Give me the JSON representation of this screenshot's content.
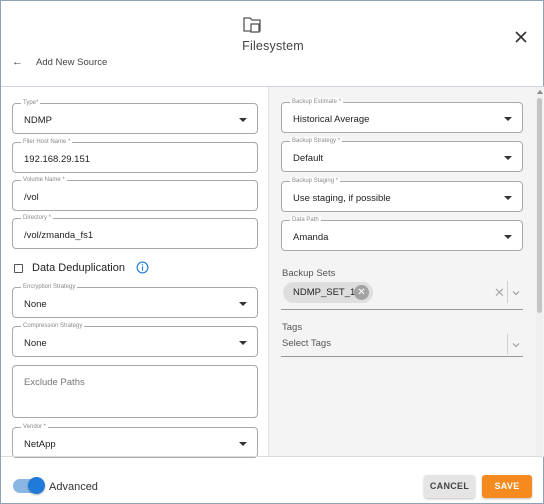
{
  "header": {
    "title": "Filesystem",
    "back_label": "Add New Source",
    "icon": "folder-copy-icon"
  },
  "left": {
    "type": {
      "label": "Type*",
      "value": "NDMP"
    },
    "filer_host": {
      "label": "Filer Host Name *",
      "value": "192.168.29.151"
    },
    "volume": {
      "label": "Volume Name *",
      "value": "/vol"
    },
    "directory": {
      "label": "Directory *",
      "value": "/vol/zmanda_fs1"
    },
    "dedup": {
      "label": "Data Deduplication",
      "checked": false
    },
    "encryption": {
      "label": "Encryption Strategy",
      "value": "None"
    },
    "compression": {
      "label": "Compression Strategy",
      "value": "None"
    },
    "exclude": {
      "placeholder": "Exclude Paths"
    },
    "vendor": {
      "label": "Vendor *",
      "value": "NetApp"
    }
  },
  "right": {
    "estimate": {
      "label": "Backup Estimate *",
      "value": "Historical Average"
    },
    "strategy": {
      "label": "Backup Strategy *",
      "value": "Default"
    },
    "staging": {
      "label": "Backup Staging *",
      "value": "Use staging, if possible"
    },
    "data_path": {
      "label": "Data Path",
      "value": "Amanda"
    },
    "backup_sets": {
      "label": "Backup Sets",
      "chips": [
        "NDMP_SET_1"
      ]
    },
    "tags": {
      "label": "Tags",
      "placeholder": "Select Tags"
    }
  },
  "footer": {
    "advanced_label": "Advanced",
    "advanced_on": true,
    "cancel_label": "CANCEL",
    "save_label": "SAVE"
  },
  "colors": {
    "accent": "#1f7ad8",
    "save": "#f58a1f",
    "right_panel_bg": "#f4f4f4"
  }
}
